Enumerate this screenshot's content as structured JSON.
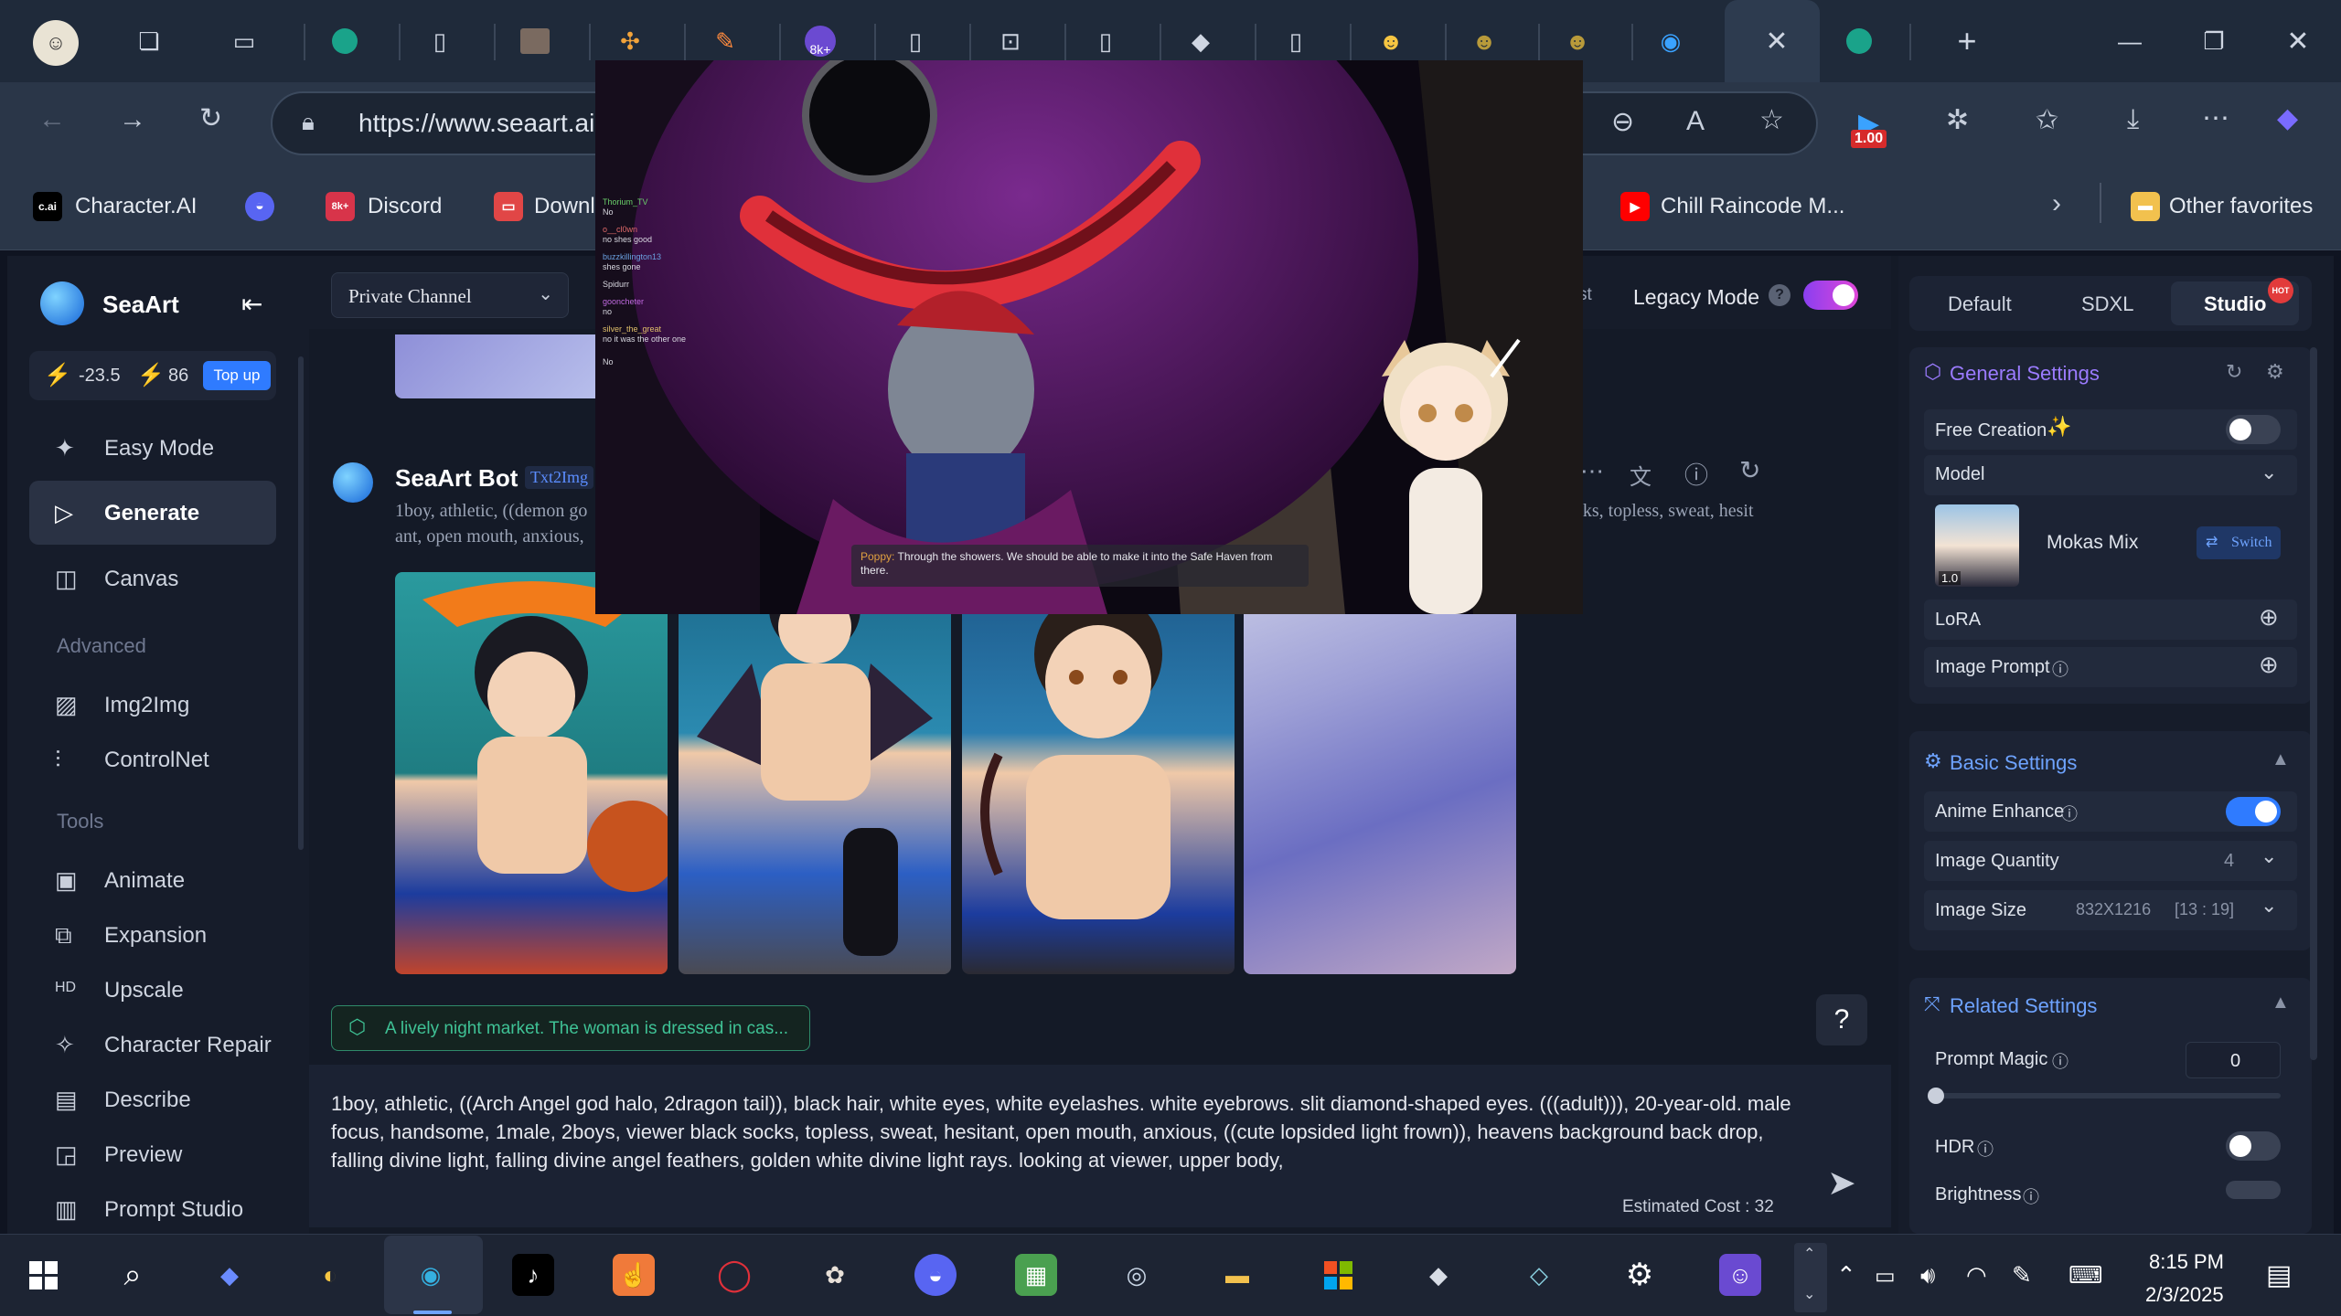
{
  "browser": {
    "url": "https://www.seaart.ai",
    "bookmarks": [
      {
        "label": "Character.AI",
        "icon": "c.ai"
      },
      {
        "label": "",
        "icon": "discord-icon"
      },
      {
        "label": "Discord",
        "icon": "8k+"
      },
      {
        "label": "Downl",
        "icon": "download-icon"
      },
      {
        "label": "Chill Raincode M...",
        "icon": "youtube-icon"
      }
    ],
    "other_favorites": "Other favorites",
    "zoom_badge": "1.00",
    "tab_badge": "8k+"
  },
  "sidebar": {
    "brand": "SeaArt",
    "credits": {
      "a": "-23.5",
      "b": "86",
      "topup": "Top up"
    },
    "items": [
      {
        "label": "Easy Mode",
        "icon": "sparkle-icon"
      },
      {
        "label": "Generate",
        "icon": "play-icon"
      },
      {
        "label": "Canvas",
        "icon": "canvas-icon"
      }
    ],
    "group_advanced": "Advanced",
    "advanced": [
      {
        "label": "Img2Img",
        "icon": "image-icon"
      },
      {
        "label": "ControlNet",
        "icon": "sliders-icon"
      }
    ],
    "group_tools": "Tools",
    "tools": [
      {
        "label": "Animate",
        "icon": "animate-icon"
      },
      {
        "label": "Expansion",
        "icon": "expand-icon"
      },
      {
        "label": "Upscale",
        "icon": "hd-icon"
      },
      {
        "label": "Character Repair",
        "icon": "repair-icon"
      },
      {
        "label": "Describe",
        "icon": "describe-icon"
      },
      {
        "label": "Preview",
        "icon": "preview-icon"
      },
      {
        "label": "Prompt Studio",
        "icon": "studio-icon"
      }
    ]
  },
  "header": {
    "channel": "Private Channel",
    "st_fragment": "st",
    "legacy_mode": "Legacy Mode"
  },
  "chat": {
    "bot_name": "SeaArt Bot",
    "bot_tag": "Txt2Img",
    "prompt_line1_left": "1boy, athletic, ((demon go",
    "prompt_line1_right": "cks, topless, sweat, hesit",
    "prompt_line2_left": "ant, open mouth, anxious,"
  },
  "suggestion": "A lively night market. The woman is dressed in cas...",
  "help": "?",
  "prompt": {
    "text": "1boy, athletic, ((Arch Angel god halo, 2dragon tail)), black hair, white eyes, white eyelashes. white eyebrows. slit diamond-shaped eyes. (((adult))), 20-year-old. male focus, handsome, 1male, 2boys, viewer black socks, topless, sweat, hesitant, open mouth, anxious, ((cute lopsided light frown)), heavens background back drop, falling divine light, falling divine angel feathers, golden white divine light rays. looking at viewer, upper body,",
    "cost": "Estimated Cost : 32"
  },
  "right_panel": {
    "tabs": [
      "Default",
      "SDXL",
      "Studio"
    ],
    "hot": "HOT",
    "general": "General Settings",
    "free_creation": "Free Creation",
    "model_label": "Model",
    "model_name": "Mokas Mix",
    "model_version": "1.0",
    "switch": "Switch",
    "lora": "LoRA",
    "image_prompt": "Image Prompt",
    "basic": "Basic Settings",
    "anime_enhance": "Anime Enhance",
    "image_quantity": "Image Quantity",
    "quantity_value": "4",
    "image_size": "Image Size",
    "size_value": "832X1216",
    "size_ratio": "[13 : 19]",
    "related": "Related Settings",
    "prompt_magic": "Prompt Magic",
    "prompt_magic_value": "0",
    "hdr": "HDR",
    "brightness": "Brightness"
  },
  "video": {
    "chat": [
      {
        "user": "Thorium_TV",
        "msg": "No"
      },
      {
        "user": "o__cl0wn",
        "msg": "no shes good"
      },
      {
        "user": "buzzkillington13",
        "msg": "shes gone"
      },
      {
        "user": "",
        "msg": "Spidurr"
      },
      {
        "user": "gooncheter",
        "msg": "no"
      },
      {
        "user": "silver_the_great",
        "msg": "no it was the other one"
      },
      {
        "user": "",
        "msg": "No"
      }
    ],
    "subtitle_speaker": "Poppy:",
    "subtitle_text": "Through the showers. We should be able to make it into the Safe Haven from there."
  },
  "taskbar": {
    "time": "8:15 PM",
    "date": "2/3/2025"
  },
  "colors": {
    "accent": "#3c7dff",
    "bg": "#141a27",
    "panel": "#1c2334",
    "legacy_toggle": "#b24bf3"
  }
}
